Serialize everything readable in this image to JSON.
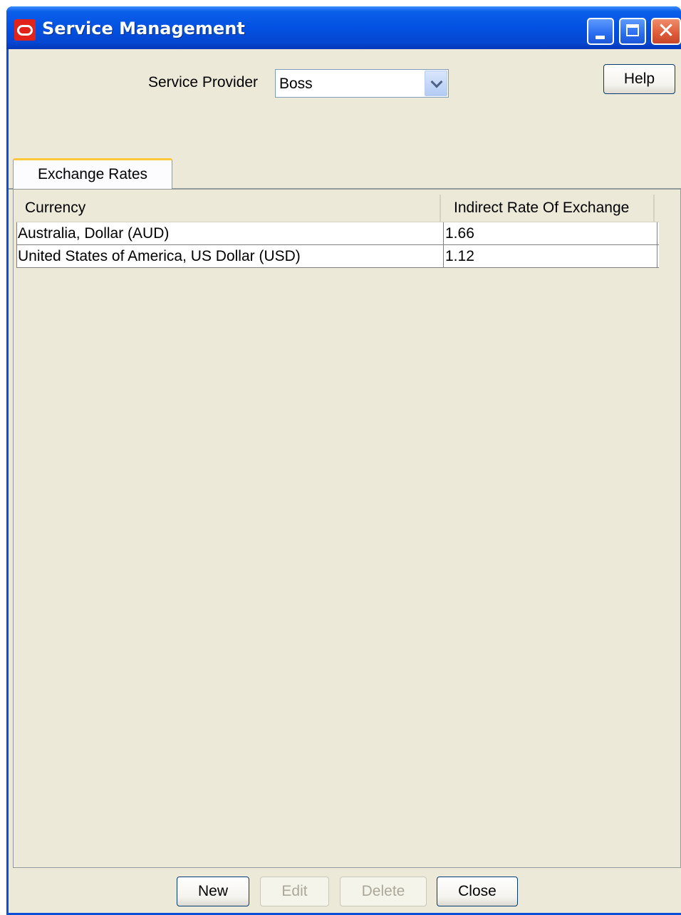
{
  "window": {
    "title": "Service Management",
    "icons": {
      "app": "oracle-logo-icon",
      "minimize": "minimize-icon",
      "maximize": "maximize-icon",
      "close": "close-icon"
    }
  },
  "toolbar": {
    "service_provider_label": "Service Provider",
    "service_provider_value": "Boss",
    "help_label": "Help"
  },
  "tabs": [
    {
      "label": "Exchange Rates",
      "selected": true
    }
  ],
  "table": {
    "columns": [
      "Currency",
      "Indirect Rate Of Exchange"
    ],
    "rows": [
      {
        "currency": "Australia, Dollar (AUD)",
        "rate": "1.66"
      },
      {
        "currency": "United States of America, US Dollar (USD)",
        "rate": "1.12"
      }
    ]
  },
  "buttons": {
    "new_label": "New",
    "edit_label": "Edit",
    "delete_label": "Delete",
    "close_label": "Close"
  },
  "colors": {
    "titlebar": "#0351e2",
    "client_background": "#ece9d8",
    "tab_highlight": "#ffc83c"
  }
}
